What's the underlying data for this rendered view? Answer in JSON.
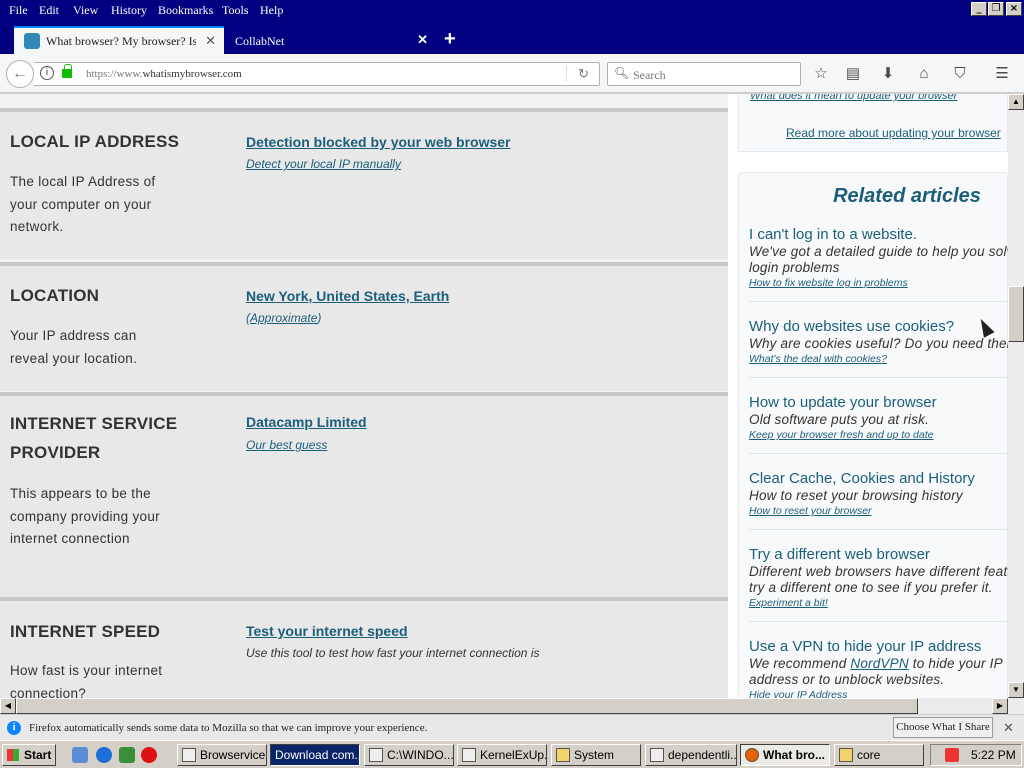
{
  "menu": [
    "File",
    "Edit",
    "View",
    "History",
    "Bookmarks",
    "Tools",
    "Help"
  ],
  "tabs": [
    {
      "title": "What browser? My browser? Is m"
    },
    {
      "title": "CollabNet"
    }
  ],
  "newtab_label": "+",
  "nav": {
    "url_prefix": "https://www.",
    "url_host": "whatismybrowser.com",
    "search_placeholder": "Search"
  },
  "sections": [
    {
      "heading": "LOCAL IP ADDRESS",
      "description": "The local IP Address of your computer on your network.",
      "value": "Detection blocked by your web browser",
      "sub": "Detect your local IP manually"
    },
    {
      "heading": "LOCATION",
      "description": "Your IP address can reveal your location.",
      "value": "New York, United States, Earth",
      "sub": "Approximate"
    },
    {
      "heading": "INTERNET SERVICE PROVIDER",
      "description": "This appears to be the company providing your internet connection",
      "value": "Datacamp Limited",
      "sub": "Our best guess"
    },
    {
      "heading": "INTERNET SPEED",
      "description": "How fast is your internet connection?",
      "value": "Test your internet speed",
      "sub": "Use this tool to test how fast your internet connection is"
    }
  ],
  "update": {
    "link1": "What does it mean to update your browser",
    "link2": "Read more about updating your browser"
  },
  "related": {
    "title": "Related articles",
    "articles": [
      {
        "title": "I can't log in to a website.",
        "desc": "We've got a detailed guide to help you solve login problems",
        "link": "How to fix website log in problems"
      },
      {
        "title": "Why do websites use cookies?",
        "desc": "Why are cookies useful? Do you need them?",
        "link": "What's the deal with cookies?"
      },
      {
        "title": "How to update your browser",
        "desc": "Old software puts you at risk.",
        "link": "Keep your browser fresh and up to date"
      },
      {
        "title": "Clear Cache, Cookies and History",
        "desc": "How to reset your browsing history",
        "link": "How to reset your browser"
      },
      {
        "title": "Try a different web browser",
        "desc": "Different web browsers have different features; try a different one to see if you prefer it.",
        "link": "Experiment a bit!"
      },
      {
        "title": "Use a VPN to hide your IP address",
        "desc_pre": "We recommend ",
        "desc_link": "NordVPN",
        "desc_post": " to hide your IP address or to unblock websites.",
        "link": "Hide your IP Address"
      }
    ]
  },
  "notification": {
    "message": "Firefox automatically sends some data to Mozilla so that we can improve your experience.",
    "button": "Choose What I Share"
  },
  "taskbar": {
    "start": "Start",
    "tasks": [
      "Browservice...",
      "Download com...",
      "C:\\WINDO...",
      "KernelExUp...",
      "System",
      "dependentli...",
      "What bro...",
      "core"
    ],
    "clock": "5:22 PM"
  }
}
